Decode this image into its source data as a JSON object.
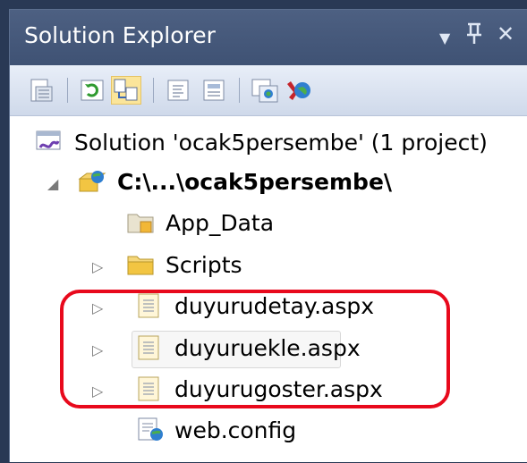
{
  "window": {
    "title": "Solution Explorer",
    "dropdown_icon": "▼",
    "pin_icon": "ᵽ",
    "close_icon": "✕"
  },
  "toolbar": {
    "buttons": [
      {
        "name": "properties-icon",
        "active": false
      },
      {
        "name": "refresh-icon",
        "active": false
      },
      {
        "name": "nest-related-files-icon",
        "active": true
      },
      {
        "name": "view-code-icon",
        "active": false
      },
      {
        "name": "view-designer-icon",
        "active": false
      },
      {
        "name": "copy-website-icon",
        "active": false
      },
      {
        "name": "aspnet-configuration-icon",
        "active": false
      }
    ]
  },
  "tree": {
    "solution": "Solution 'ocak5persembe' (1 project)",
    "project": "C:\\...\\ocak5persembe\\",
    "items": [
      {
        "label": "App_Data",
        "icon": "folder-data-icon",
        "expander": ""
      },
      {
        "label": "Scripts",
        "icon": "folder-icon",
        "expander": "▷"
      },
      {
        "label": "duyurudetay.aspx",
        "icon": "aspx-page-icon",
        "expander": "▷"
      },
      {
        "label": "duyuruekle.aspx",
        "icon": "aspx-page-icon",
        "expander": "▷"
      },
      {
        "label": "duyurugoster.aspx",
        "icon": "aspx-page-icon",
        "expander": "▷"
      },
      {
        "label": "web.config",
        "icon": "config-file-icon",
        "expander": ""
      }
    ],
    "project_expander": "◢"
  },
  "colors": {
    "titlebar": "#4d6082",
    "highlight": "#e8091c",
    "selected": "#fbe59a"
  }
}
